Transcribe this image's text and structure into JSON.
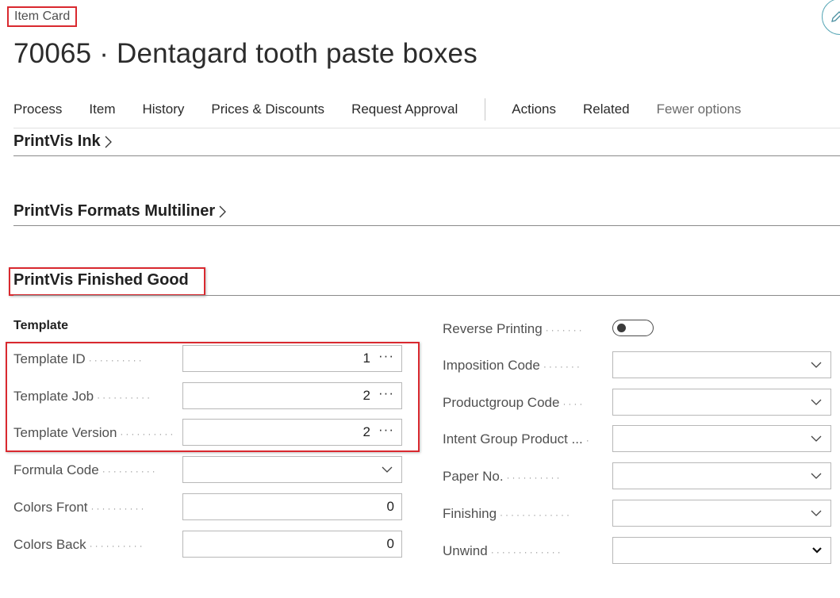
{
  "breadcrumb": "Item Card",
  "title": "70065 · Dentagard tooth paste boxes",
  "actions": [
    "Process",
    "Item",
    "History",
    "Prices & Discounts",
    "Request Approval"
  ],
  "actions2": [
    "Actions",
    "Related"
  ],
  "fewer_options": "Fewer options",
  "sections": {
    "ink": "PrintVis Ink",
    "formats": "PrintVis Formats Multiliner",
    "finished": "PrintVis Finished Good"
  },
  "group": "Template",
  "left_fields": [
    {
      "label": "Template ID",
      "value": "1"
    },
    {
      "label": "Template Job",
      "value": "2"
    },
    {
      "label": "Template Version",
      "value": "2"
    },
    {
      "label": "Formula Code",
      "value": ""
    },
    {
      "label": "Colors Front",
      "value": "0"
    },
    {
      "label": "Colors Back",
      "value": "0"
    }
  ],
  "right_fields": [
    {
      "label": "Reverse Printing",
      "value": "off"
    },
    {
      "label": "Imposition Code",
      "value": ""
    },
    {
      "label": "Productgroup Code",
      "value": ""
    },
    {
      "label": "Intent Group Product ...",
      "value": ""
    },
    {
      "label": "Paper No.",
      "value": ""
    },
    {
      "label": "Finishing",
      "value": ""
    },
    {
      "label": "Unwind",
      "value": ""
    }
  ],
  "lookup_glyph": "···",
  "colors": {
    "highlight": "#d9292f",
    "accent": "#5aa8b7"
  },
  "icons": {
    "edit": "pencil-icon",
    "chevron": "chevron-right-icon",
    "dropdown": "chevron-down-icon"
  }
}
